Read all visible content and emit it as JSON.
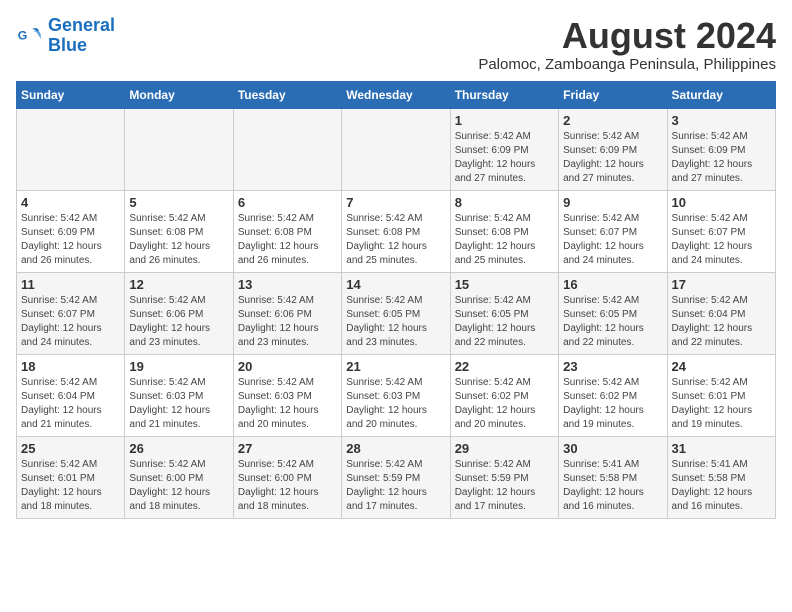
{
  "header": {
    "logo_line1": "General",
    "logo_line2": "Blue",
    "month_year": "August 2024",
    "location": "Palomoc, Zamboanga Peninsula, Philippines"
  },
  "days_of_week": [
    "Sunday",
    "Monday",
    "Tuesday",
    "Wednesday",
    "Thursday",
    "Friday",
    "Saturday"
  ],
  "weeks": [
    [
      {
        "day": "",
        "info": ""
      },
      {
        "day": "",
        "info": ""
      },
      {
        "day": "",
        "info": ""
      },
      {
        "day": "",
        "info": ""
      },
      {
        "day": "1",
        "info": "Sunrise: 5:42 AM\nSunset: 6:09 PM\nDaylight: 12 hours\nand 27 minutes."
      },
      {
        "day": "2",
        "info": "Sunrise: 5:42 AM\nSunset: 6:09 PM\nDaylight: 12 hours\nand 27 minutes."
      },
      {
        "day": "3",
        "info": "Sunrise: 5:42 AM\nSunset: 6:09 PM\nDaylight: 12 hours\nand 27 minutes."
      }
    ],
    [
      {
        "day": "4",
        "info": "Sunrise: 5:42 AM\nSunset: 6:09 PM\nDaylight: 12 hours\nand 26 minutes."
      },
      {
        "day": "5",
        "info": "Sunrise: 5:42 AM\nSunset: 6:08 PM\nDaylight: 12 hours\nand 26 minutes."
      },
      {
        "day": "6",
        "info": "Sunrise: 5:42 AM\nSunset: 6:08 PM\nDaylight: 12 hours\nand 26 minutes."
      },
      {
        "day": "7",
        "info": "Sunrise: 5:42 AM\nSunset: 6:08 PM\nDaylight: 12 hours\nand 25 minutes."
      },
      {
        "day": "8",
        "info": "Sunrise: 5:42 AM\nSunset: 6:08 PM\nDaylight: 12 hours\nand 25 minutes."
      },
      {
        "day": "9",
        "info": "Sunrise: 5:42 AM\nSunset: 6:07 PM\nDaylight: 12 hours\nand 24 minutes."
      },
      {
        "day": "10",
        "info": "Sunrise: 5:42 AM\nSunset: 6:07 PM\nDaylight: 12 hours\nand 24 minutes."
      }
    ],
    [
      {
        "day": "11",
        "info": "Sunrise: 5:42 AM\nSunset: 6:07 PM\nDaylight: 12 hours\nand 24 minutes."
      },
      {
        "day": "12",
        "info": "Sunrise: 5:42 AM\nSunset: 6:06 PM\nDaylight: 12 hours\nand 23 minutes."
      },
      {
        "day": "13",
        "info": "Sunrise: 5:42 AM\nSunset: 6:06 PM\nDaylight: 12 hours\nand 23 minutes."
      },
      {
        "day": "14",
        "info": "Sunrise: 5:42 AM\nSunset: 6:05 PM\nDaylight: 12 hours\nand 23 minutes."
      },
      {
        "day": "15",
        "info": "Sunrise: 5:42 AM\nSunset: 6:05 PM\nDaylight: 12 hours\nand 22 minutes."
      },
      {
        "day": "16",
        "info": "Sunrise: 5:42 AM\nSunset: 6:05 PM\nDaylight: 12 hours\nand 22 minutes."
      },
      {
        "day": "17",
        "info": "Sunrise: 5:42 AM\nSunset: 6:04 PM\nDaylight: 12 hours\nand 22 minutes."
      }
    ],
    [
      {
        "day": "18",
        "info": "Sunrise: 5:42 AM\nSunset: 6:04 PM\nDaylight: 12 hours\nand 21 minutes."
      },
      {
        "day": "19",
        "info": "Sunrise: 5:42 AM\nSunset: 6:03 PM\nDaylight: 12 hours\nand 21 minutes."
      },
      {
        "day": "20",
        "info": "Sunrise: 5:42 AM\nSunset: 6:03 PM\nDaylight: 12 hours\nand 20 minutes."
      },
      {
        "day": "21",
        "info": "Sunrise: 5:42 AM\nSunset: 6:03 PM\nDaylight: 12 hours\nand 20 minutes."
      },
      {
        "day": "22",
        "info": "Sunrise: 5:42 AM\nSunset: 6:02 PM\nDaylight: 12 hours\nand 20 minutes."
      },
      {
        "day": "23",
        "info": "Sunrise: 5:42 AM\nSunset: 6:02 PM\nDaylight: 12 hours\nand 19 minutes."
      },
      {
        "day": "24",
        "info": "Sunrise: 5:42 AM\nSunset: 6:01 PM\nDaylight: 12 hours\nand 19 minutes."
      }
    ],
    [
      {
        "day": "25",
        "info": "Sunrise: 5:42 AM\nSunset: 6:01 PM\nDaylight: 12 hours\nand 18 minutes."
      },
      {
        "day": "26",
        "info": "Sunrise: 5:42 AM\nSunset: 6:00 PM\nDaylight: 12 hours\nand 18 minutes."
      },
      {
        "day": "27",
        "info": "Sunrise: 5:42 AM\nSunset: 6:00 PM\nDaylight: 12 hours\nand 18 minutes."
      },
      {
        "day": "28",
        "info": "Sunrise: 5:42 AM\nSunset: 5:59 PM\nDaylight: 12 hours\nand 17 minutes."
      },
      {
        "day": "29",
        "info": "Sunrise: 5:42 AM\nSunset: 5:59 PM\nDaylight: 12 hours\nand 17 minutes."
      },
      {
        "day": "30",
        "info": "Sunrise: 5:41 AM\nSunset: 5:58 PM\nDaylight: 12 hours\nand 16 minutes."
      },
      {
        "day": "31",
        "info": "Sunrise: 5:41 AM\nSunset: 5:58 PM\nDaylight: 12 hours\nand 16 minutes."
      }
    ]
  ]
}
